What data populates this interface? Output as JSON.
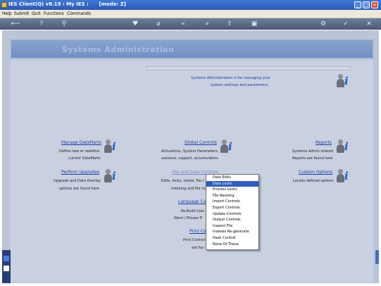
{
  "window": {
    "title": "IES Client(Q) v8.19 : My IES :      [mode: Z]"
  },
  "menu": [
    "Help",
    "Submit",
    "Quit",
    "Functions",
    "Commands"
  ],
  "toolbar_glyphs": [
    "⟵",
    "?",
    "⚲",
    "♥",
    "⌀",
    "«",
    "»",
    "⇧",
    "▣",
    "⚙",
    "✓",
    "✕"
  ],
  "banner": {
    "title": "Systems Administration"
  },
  "intro": {
    "line1": "Systems Administration is for managing your",
    "line2": "system settings and parameters."
  },
  "sections": {
    "manage_datamarts": {
      "title": "Manage DataMarts",
      "l1": "Define new or redefine",
      "l2": "current DataMarts"
    },
    "global_controls": {
      "title": "Global Controls",
      "l1": "Activations, System Parameters,",
      "l2": "sessions, support, accumulators"
    },
    "reports": {
      "title": "Reports",
      "l1": "Systems Admin related",
      "l2": "Reports are found here"
    },
    "perform_upgrades": {
      "title": "Perform Upgrades",
      "l1": "Upgrade and Data Overlay",
      "l2": "options are found here"
    },
    "file_data_controls": {
      "title": "File and Data Controls",
      "l1": "Edits, locks, resize, file c",
      "l2": "indexing and file insp"
    },
    "custom_options": {
      "title": "Custom Options",
      "l1": "Locally defined options"
    },
    "language_controls": {
      "title": "Language Co",
      "l1": "Re-Build User",
      "l2": "Word / Phrase Tr"
    },
    "print_controls": {
      "title": "Print Co",
      "l1": "Print Control",
      "l2": "are fou"
    }
  },
  "context_menu": {
    "items": [
      "Data Edits",
      "Data Locks",
      "Process Locks",
      "File Resizing",
      "Import Controls",
      "Export Controls",
      "Update Controls",
      "Output Controls",
      "Inspect File",
      "Indexes Re-generate",
      "Hash Control",
      "None Of These"
    ],
    "selected": "Data Locks"
  }
}
